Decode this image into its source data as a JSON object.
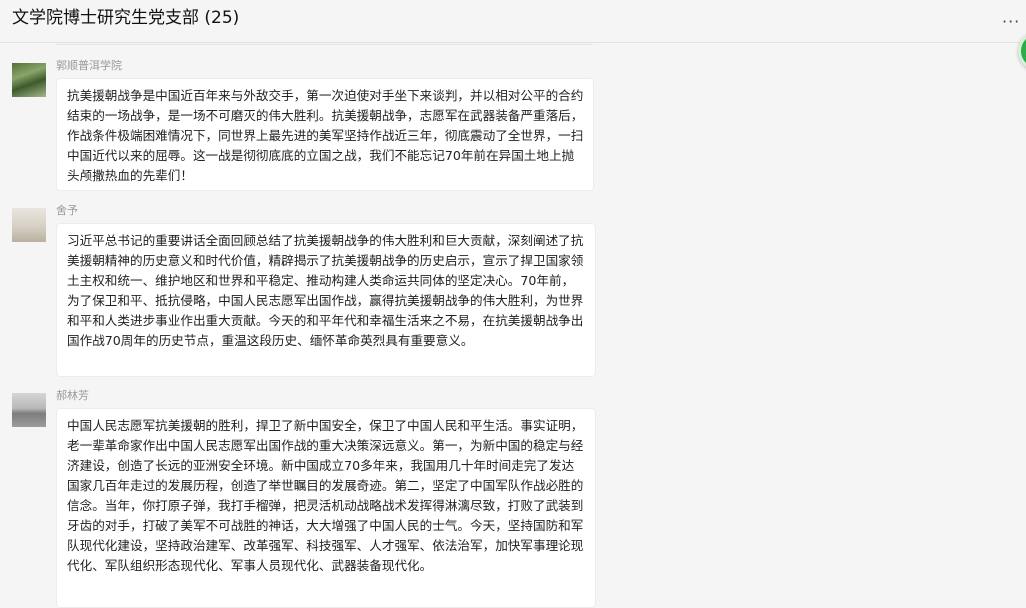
{
  "chat": {
    "title": "文学院博士研究生党支部 (25)",
    "more_label": "···"
  },
  "messages": [
    {
      "sender": "郭顺普洱学院",
      "text": "抗美援朝战争是中国近百年来与外敌交手，第一次迫使对手坐下来谈判，并以相对公平的合约结束的一场战争，是一场不可磨灭的伟大胜利。抗美援朝战争，志愿军在武器装备严重落后，作战条件极端困难情况下，同世界上最先进的美军坚持作战近三年，彻底震动了全世界，一扫中国近代以来的屈辱。这一战是彻彻底底的立国之战，我们不能忘记70年前在异国土地上抛头颅撒热血的先辈们！"
    },
    {
      "sender": "舍予",
      "text": "习近平总书记的重要讲话全面回顾总结了抗美援朝战争的伟大胜利和巨大贡献，深刻阐述了抗美援朝精神的历史意义和时代价值，精辟揭示了抗美援朝战争的历史启示，宣示了捍卫国家领土主权和统一、维护地区和世界和平稳定、推动构建人类命运共同体的坚定决心。70年前，为了保卫和平、抵抗侵略，中国人民志愿军出国作战，赢得抗美援朝战争的伟大胜利，为世界和平和人类进步事业作出重大贡献。今天的和平年代和幸福生活来之不易，在抗美援朝战争出国作战70周年的历史节点，重温这段历史、缅怀革命英烈具有重要意义。"
    },
    {
      "sender": "郝林芳",
      "text": "中国人民志愿军抗美援朝的胜利，捍卫了新中国安全，保卫了中国人民和平生活。事实证明，老一辈革命家作出中国人民志愿军出国作战的重大决策深远意义。第一，为新中国的稳定与经济建设，创造了长远的亚洲安全环境。新中国成立70多年来，我国用几十年时间走完了发达国家几百年走过的发展历程，创造了举世瞩目的发展奇迹。第二，坚定了中国军队作战必胜的信念。当年，你打原子弹，我打手榴弹，把灵活机动战略战术发挥得淋漓尽致，打败了武装到牙齿的对手，打破了美军不可战胜的神话，大大增强了中国人民的士气。今天，坚持国防和军队现代化建设，坚持政治建军、改革强军、科技强军、人才强军、依法治军，加快军事理论现代化、军队组织形态现代化、军事人员现代化、武器装备现代化。"
    }
  ]
}
